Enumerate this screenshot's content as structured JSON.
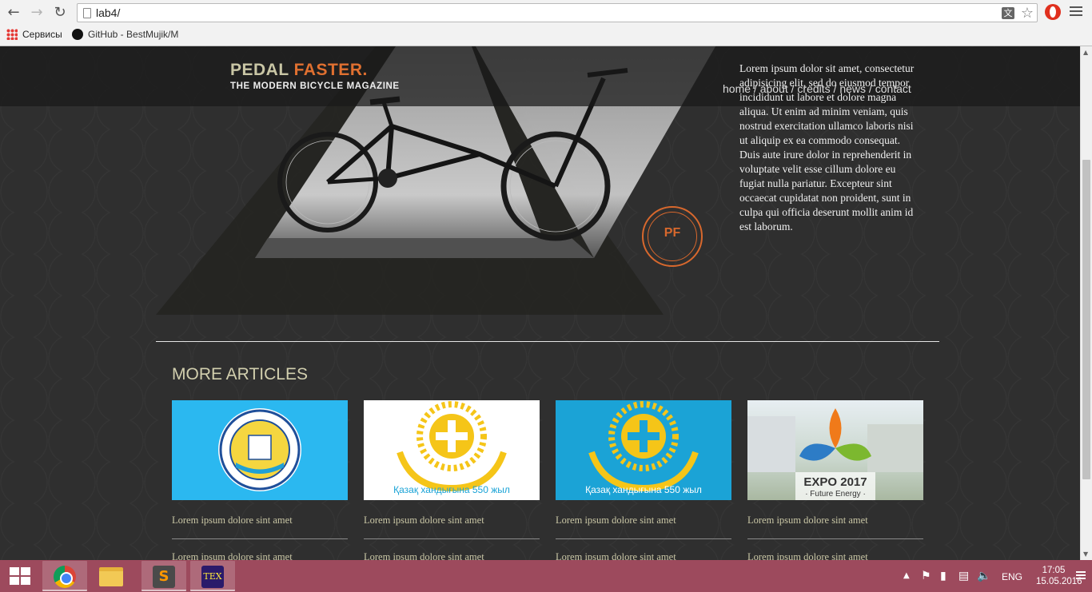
{
  "browser": {
    "url": "lab4/",
    "bookmarks": [
      "Сервисы",
      "GitHub - BestMujik/M"
    ],
    "icons": [
      "back-icon",
      "forward-icon",
      "reload-icon",
      "page-icon",
      "translate-icon",
      "star-icon",
      "opera-icon",
      "menu-icon"
    ]
  },
  "site": {
    "logo_main": "PEDAL ",
    "logo_accent": "FASTER.",
    "tagline": "THE MODERN BICYCLE MAGAZINE",
    "nav": [
      "home",
      "about",
      "credits",
      "news",
      "contact"
    ],
    "nav_sep": " / ",
    "intro": "Lorem ipsum dolor sit amet, consectetur adipisicing elit, sed do eiusmod tempor incididunt ut labore et dolore magna aliqua. Ut enim ad minim veniam, quis nostrud exercitation ullamco laboris nisi ut aliquip ex ea commodo consequat. Duis aute irure dolor in reprehenderit in voluptate velit esse cillum dolore eu fugiat nulla pariatur. Excepteur sint occaecat cupidatat non proident, sunt in culpa qui officia deserunt mollit anim id est laborum.",
    "badge": "PF",
    "more_title": "MORE ARTICLES",
    "articles": [
      {
        "caption": "Lorem ipsum dolore sint amet",
        "caption2": "Lorem ipsum dolore sint amet",
        "image": "election-commission-seal",
        "bg": "#2bb8f0"
      },
      {
        "caption": "Lorem ipsum dolore sint amet",
        "caption2": "Lorem ipsum dolore sint amet",
        "image": "kazakh-khanate-550-emblem-white",
        "bg": "#ffffff"
      },
      {
        "caption": "Lorem ipsum dolore sint amet",
        "caption2": "Lorem ipsum dolore sint amet",
        "image": "kazakh-khanate-550-emblem-blue",
        "bg": "#1ba3d6"
      },
      {
        "caption": "Lorem ipsum dolore sint amet",
        "caption2": "Lorem ipsum dolore sint amet",
        "image": "expo-2017-logo",
        "bg": "#dfe7ea"
      }
    ],
    "expo_title": "EXPO 2017",
    "expo_sub": "· Future Energy ·",
    "emblem_text": "Қазақ хандығына 550 жыл"
  },
  "taskbar": {
    "apps": [
      "windows-start-icon",
      "chrome-icon",
      "file-explorer-icon",
      "sublime-text-icon",
      "texmaker-icon"
    ],
    "lang": "ENG",
    "time": "17:05",
    "date": "15.05.2016"
  },
  "colors": {
    "accent": "#e07030",
    "logo": "#c9c6a5",
    "taskbar": "#9d4a5d"
  }
}
